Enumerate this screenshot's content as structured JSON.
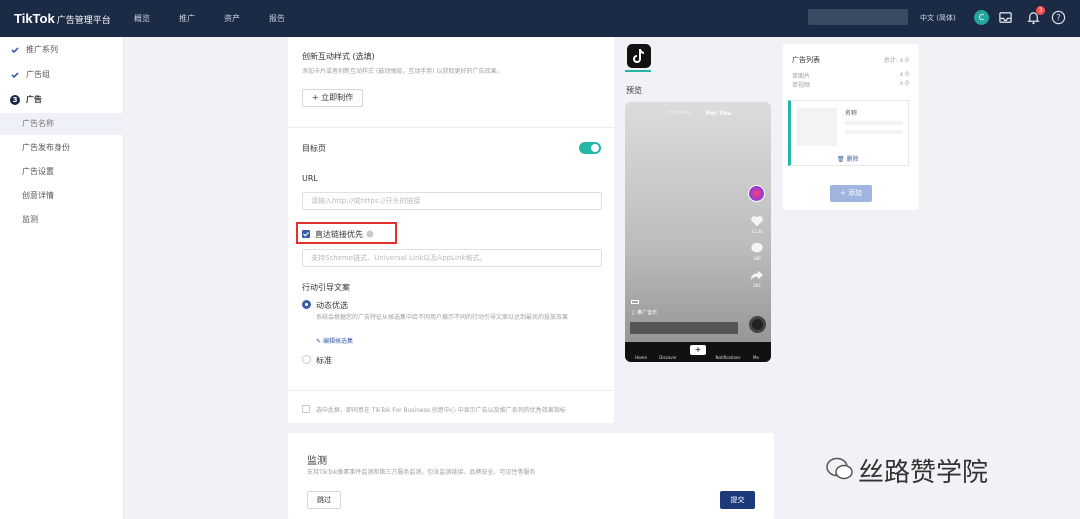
{
  "topbar": {
    "logo": "TikTok",
    "logo_sub": "广告管理平台",
    "nav": [
      "概览",
      "推广",
      "资产",
      "报告"
    ],
    "lang": "中文 (简体)",
    "avatar": "C",
    "notif_count": "3"
  },
  "sidebar": {
    "items": [
      {
        "label": "推广系列",
        "state": "done"
      },
      {
        "label": "广告组",
        "state": "done"
      },
      {
        "label": "广告",
        "state": "current",
        "num": "3"
      },
      {
        "label": "广告名称",
        "state": "active"
      },
      {
        "label": "广告发布身份",
        "state": "todo"
      },
      {
        "label": "广告设置",
        "state": "todo"
      },
      {
        "label": "创意详情",
        "state": "todo"
      },
      {
        "label": "监测",
        "state": "todo"
      }
    ]
  },
  "form": {
    "interactive_title": "创新互动样式 (选填)",
    "interactive_desc": "添加卡片或者创新互动样式 (鼓动弹层，互动手势) 以获取更好的广告效果。",
    "make_now": "+ 立即制作",
    "target_page": "目标页",
    "url_label": "URL",
    "url_placeholder": "请输入http://或https://开头的链接",
    "deeplink_label": "直达链接优先",
    "deeplink_placeholder": "支持Scheme链式、Universal Link以及AppLink格式。",
    "cta_label": "行动引导文案",
    "cta_dynamic": "动态优选",
    "cta_dynamic_desc": "系统会根据您的广告特征从候选集中给不同用户展示不同的行动引导文案以达到最优的投放效果",
    "edit_candidates": "编辑候选集",
    "cta_standard": "标准",
    "consent": "选中此框，即同意在 TikTok For Business 创意中心 中显示广告以及推广系列的优秀效果指标"
  },
  "preview": {
    "label": "预览",
    "following": "Following",
    "for_you": "For You",
    "music": "♫ 推广音乐",
    "likes": "11.2k",
    "comments": "186",
    "shares": "202",
    "bottom_nav": [
      "Home",
      "Discover",
      "+",
      "Notifications",
      "Me"
    ]
  },
  "ad_list": {
    "title": "广告列表",
    "total": "总计: x 0",
    "rows": [
      {
        "label": "单图片",
        "value": "x 0"
      },
      {
        "label": "单视频",
        "value": "x 0"
      }
    ],
    "item_name": "名称",
    "delete": "删除",
    "add": "+ 添加"
  },
  "monitor": {
    "title": "监测",
    "desc": "支持TikTok像素事件监测和第三方服务监测，包含监测链接、品牌安全、可见性等服务",
    "skip": "跳过",
    "submit": "提交"
  },
  "watermark": "丝路赞学院",
  "colors": {
    "topbar": "#1c2b45",
    "accent": "#3a5ea8",
    "teal": "#26b6a6",
    "highlight": "#e03030"
  }
}
